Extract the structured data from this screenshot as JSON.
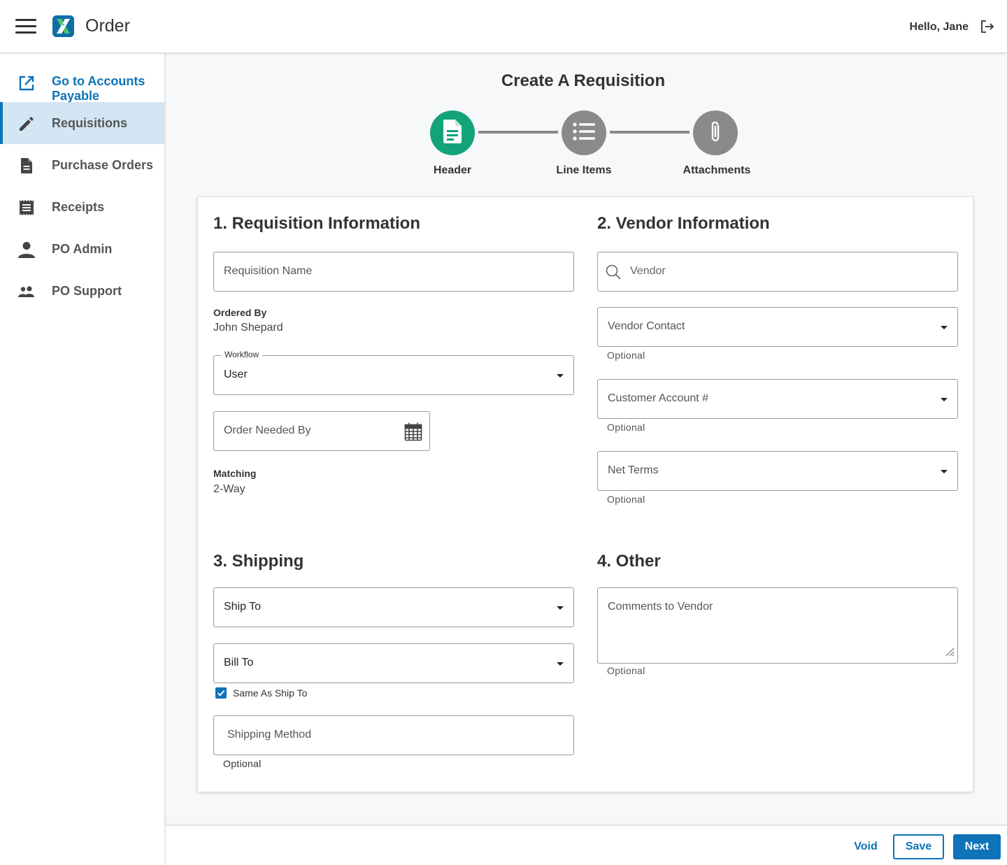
{
  "header": {
    "app_title": "Order",
    "greeting": "Hello, Jane"
  },
  "sidebar": {
    "items": [
      {
        "label": "Go to Accounts Payable",
        "icon": "external-link-icon"
      },
      {
        "label": "Requisitions",
        "icon": "pencil-icon",
        "active": true
      },
      {
        "label": "Purchase Orders",
        "icon": "document-icon"
      },
      {
        "label": "Receipts",
        "icon": "receipt-icon"
      },
      {
        "label": "PO Admin",
        "icon": "person-icon"
      },
      {
        "label": "PO Support",
        "icon": "people-icon"
      }
    ]
  },
  "page_title": "Create A Requisition",
  "stepper": {
    "steps": [
      {
        "label": "Header",
        "icon": "document-icon",
        "state": "active"
      },
      {
        "label": "Line Items",
        "icon": "list-icon",
        "state": "inactive"
      },
      {
        "label": "Attachments",
        "icon": "paperclip-icon",
        "state": "inactive"
      }
    ]
  },
  "sections": {
    "requisition": {
      "title": "1. Requisition Information",
      "name_placeholder": "Requisition Name",
      "ordered_by_label": "Ordered By",
      "ordered_by_value": "John Shepard",
      "workflow_label": "Workflow",
      "workflow_value": "User",
      "needed_by_placeholder": "Order Needed By",
      "matching_label": "Matching",
      "matching_value": "2-Way"
    },
    "vendor": {
      "title": "2. Vendor Information",
      "vendor_placeholder": "Vendor",
      "contact_placeholder": "Vendor Contact",
      "contact_helper": "Optional",
      "account_placeholder": "Customer Account #",
      "account_helper": "Optional",
      "terms_placeholder": "Net Terms",
      "terms_helper": "Optional"
    },
    "shipping": {
      "title": "3. Shipping",
      "ship_to_placeholder": "Ship To",
      "bill_to_placeholder": "Bill To",
      "same_as_label": "Same As Ship To",
      "same_as_checked": true,
      "method_placeholder": "Shipping Method",
      "method_helper": "Optional"
    },
    "other": {
      "title": "4. Other",
      "comments_placeholder": "Comments to Vendor",
      "comments_helper": "Optional"
    }
  },
  "footer": {
    "void_label": "Void",
    "save_label": "Save",
    "next_label": "Next"
  },
  "colors": {
    "accent": "#0e73b8",
    "step_active": "#13a37a",
    "step_inactive": "#8a8a8a",
    "active_nav_bg": "#d2e6f3"
  }
}
